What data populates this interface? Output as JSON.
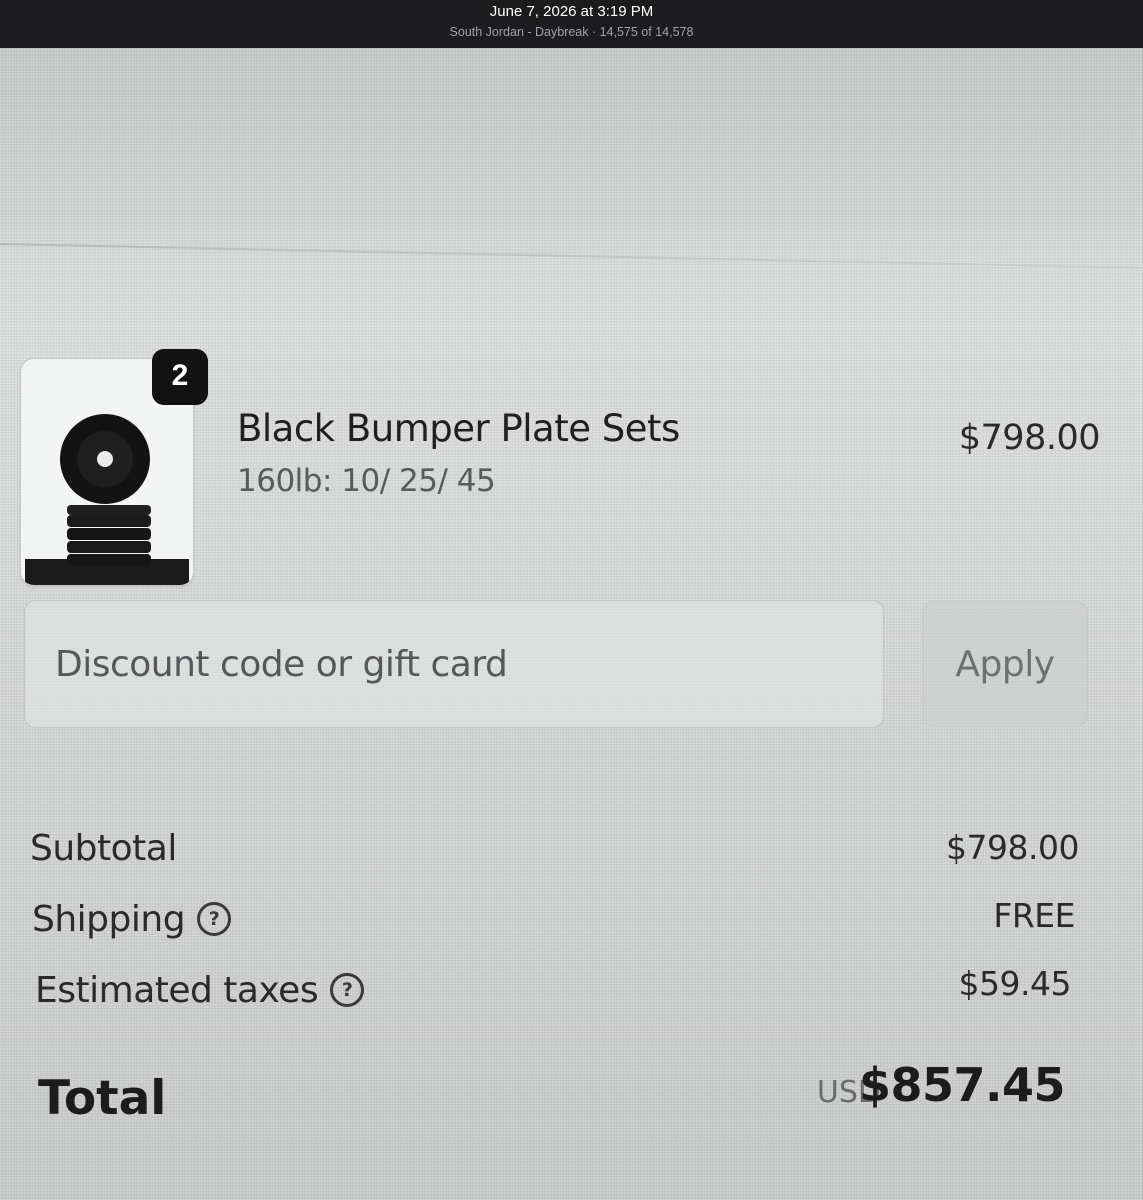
{
  "photo_viewer": {
    "date": "June 7, 2026 at 3:19 PM",
    "location_info": "South Jordan - Daybreak · 14,575 of 14,578"
  },
  "order_summary": {
    "item": {
      "quantity": "2",
      "title": "Black Bumper Plate Sets",
      "variant": "160lb: 10/ 25/ 45",
      "price": "$798.00",
      "image": "black-bumper-plates-image"
    },
    "discount": {
      "placeholder": "Discount code or gift card",
      "value": "",
      "apply_label": "Apply"
    },
    "subtotal_label": "Subtotal",
    "subtotal_value": "$798.00",
    "shipping_label": "Shipping",
    "shipping_value": "FREE",
    "taxes_label": "Estimated taxes",
    "taxes_value": "$59.45",
    "help_icon": "question-circle-icon",
    "total_label": "Total",
    "currency": "USD",
    "total_value": "$857.45"
  }
}
